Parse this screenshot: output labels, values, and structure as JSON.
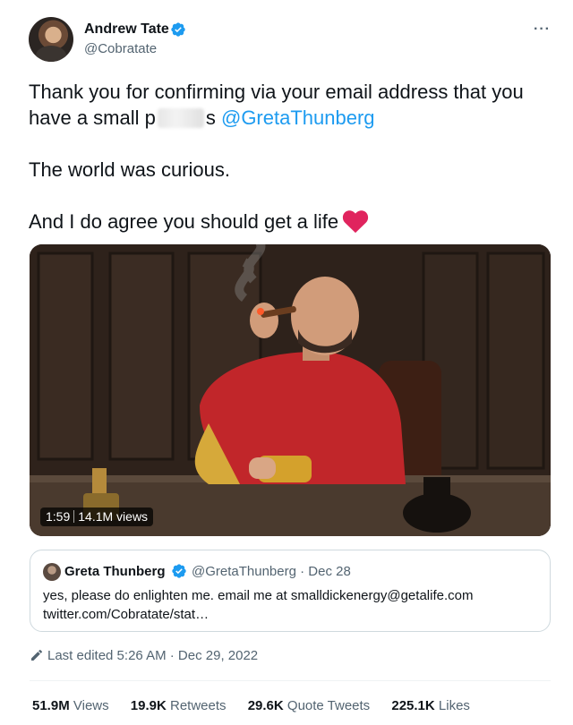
{
  "author": {
    "name": "Andrew Tate",
    "handle": "@Cobratate",
    "verified": true
  },
  "tweet": {
    "line1_part1": "Thank you for confirming via your email address that you have a small p",
    "line1_blurred_suffix": "s",
    "mention": "@GretaThunberg",
    "paragraph2": "The world was curious.",
    "paragraph3": "And I do agree you should get a life",
    "emoji": "heart-icon"
  },
  "media": {
    "duration": "1:59",
    "views": "14.1M views"
  },
  "quoted_tweet": {
    "name": "Greta Thunberg",
    "handle": "@GretaThunberg",
    "date": "· Dec 28",
    "text": "yes, please do enlighten me. email me at smalldickenergy@getalife.com twitter.com/Cobratate/stat…"
  },
  "meta": {
    "edited_label": "Last edited 5:26 AM · Dec 29, 2022"
  },
  "stats": {
    "views_count": "51.9M",
    "views_label": "Views",
    "retweets_count": "19.9K",
    "retweets_label": "Retweets",
    "quotes_count": "29.6K",
    "quotes_label": "Quote Tweets",
    "likes_count": "225.1K",
    "likes_label": "Likes"
  },
  "colors": {
    "link": "#1d9bf0",
    "verified": "#1d9bf0",
    "heart": "#e0245e",
    "secondary_text": "#536471"
  }
}
